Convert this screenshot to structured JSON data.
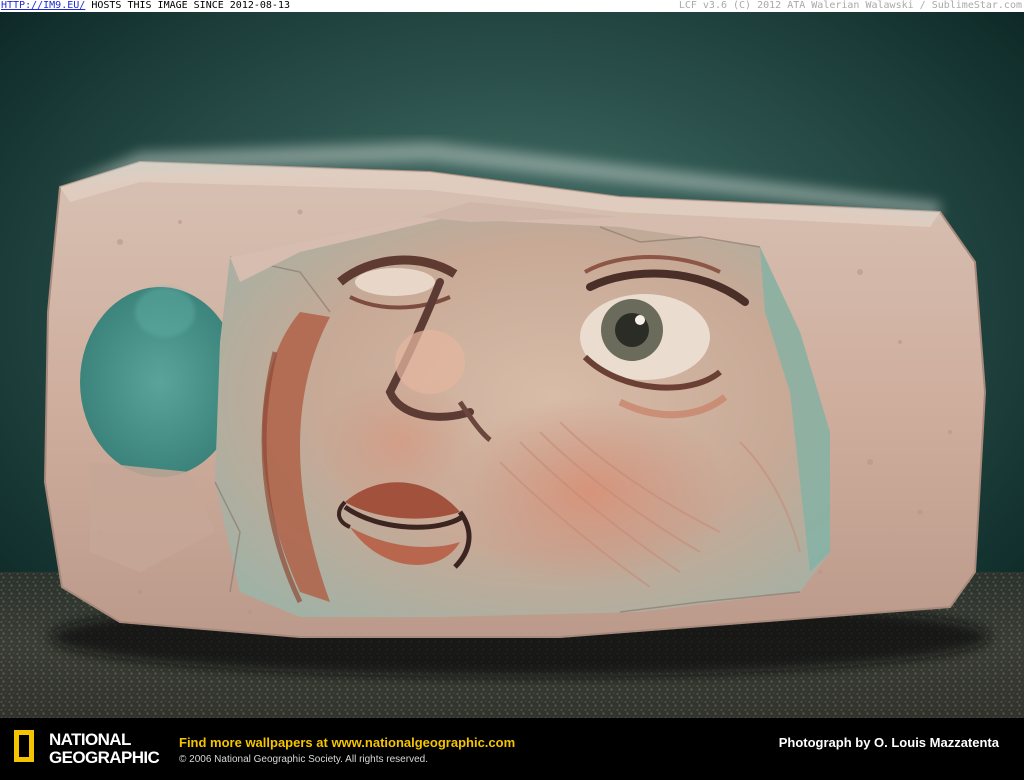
{
  "watermark": {
    "link_text": "HTTP://IM9.EU/",
    "host_text": " HOSTS THIS IMAGE SINCE 2012-08-13",
    "right_text": "LCF v3.6 (C) 2012 ATA Walerian Walawski / SublimeStar.com"
  },
  "footer": {
    "logo_line1": "NATIONAL",
    "logo_line2": "GEOGRAPHIC",
    "find_more_prefix": "Find more wallpapers at ",
    "find_more_url": "www.nationalgeographic.com",
    "copyright": "© 2006 National Geographic Society. All rights reserved.",
    "photo_credit": "Photograph by O. Louis Mazzatenta"
  },
  "colors": {
    "natgeo_yellow": "#f5c400",
    "background": "#000000",
    "link_blue": "#1d2bd6"
  }
}
